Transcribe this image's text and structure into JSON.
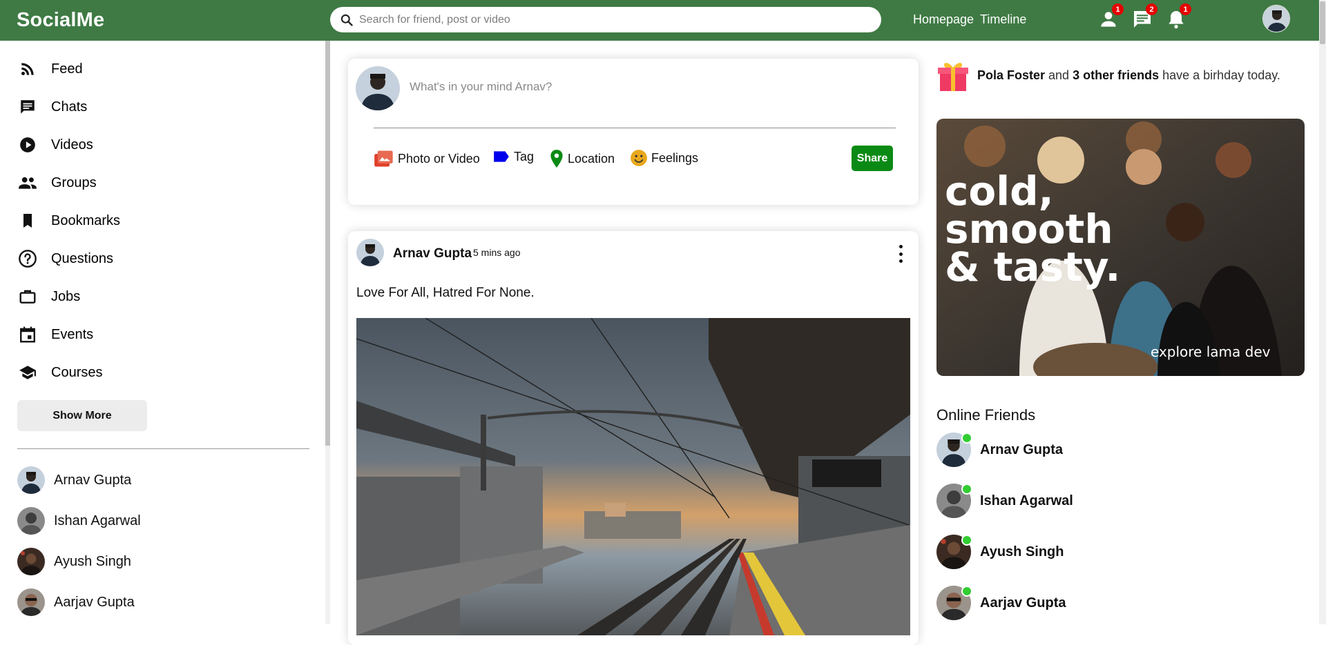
{
  "app": {
    "logo": "SocialMe",
    "search_placeholder": "Search for friend, post or video",
    "links": [
      "Homepage",
      "Timeline"
    ],
    "icons": [
      {
        "name": "person-icon",
        "badge": "1"
      },
      {
        "name": "chat-icon",
        "badge": "2"
      },
      {
        "name": "notification-icon",
        "badge": "1"
      }
    ]
  },
  "sidebar": {
    "items": [
      {
        "label": "Feed",
        "icon": "rss-feed-icon"
      },
      {
        "label": "Chats",
        "icon": "chat-icon"
      },
      {
        "label": "Videos",
        "icon": "play-circle-icon"
      },
      {
        "label": "Groups",
        "icon": "group-icon"
      },
      {
        "label": "Bookmarks",
        "icon": "bookmark-icon"
      },
      {
        "label": "Questions",
        "icon": "help-circle-icon"
      },
      {
        "label": "Jobs",
        "icon": "briefcase-icon"
      },
      {
        "label": "Events",
        "icon": "calendar-icon"
      },
      {
        "label": "Courses",
        "icon": "school-icon"
      }
    ],
    "show_more": "Show More",
    "friends": [
      "Arnav Gupta",
      "Ishan Agarwal",
      "Ayush Singh",
      "Aarjav Gupta"
    ]
  },
  "share": {
    "placeholder": "What's in your mind Arnav?",
    "options": [
      {
        "label": "Photo or Video",
        "icon": "photo-icon",
        "color": "#e0402a"
      },
      {
        "label": "Tag",
        "icon": "label-icon",
        "color": "#0000ee"
      },
      {
        "label": "Location",
        "icon": "location-icon",
        "color": "#0a8a15"
      },
      {
        "label": "Feelings",
        "icon": "emoji-icon",
        "color": "#e8a81c"
      }
    ],
    "button": "Share"
  },
  "post": {
    "author": "Arnav Gupta",
    "time": "5 mins ago",
    "text": "Love For All, Hatred For None."
  },
  "rightbar": {
    "birthday": {
      "name": "Pola Foster",
      "mid": " and ",
      "others": "3 other friends",
      "tail": " have a birhday today."
    },
    "ad": {
      "line1": "cold,",
      "line2": "smooth",
      "line3": "& tasty.",
      "tagline": "explore lama dev"
    },
    "online_title": "Online Friends",
    "online": [
      "Arnav Gupta",
      "Ishan Agarwal",
      "Ayush Singh",
      "Aarjav Gupta"
    ]
  },
  "colors": {
    "brand": "#3f7a44",
    "share": "#0a8a15",
    "online": "#32cd32",
    "badge": "#e60000"
  }
}
